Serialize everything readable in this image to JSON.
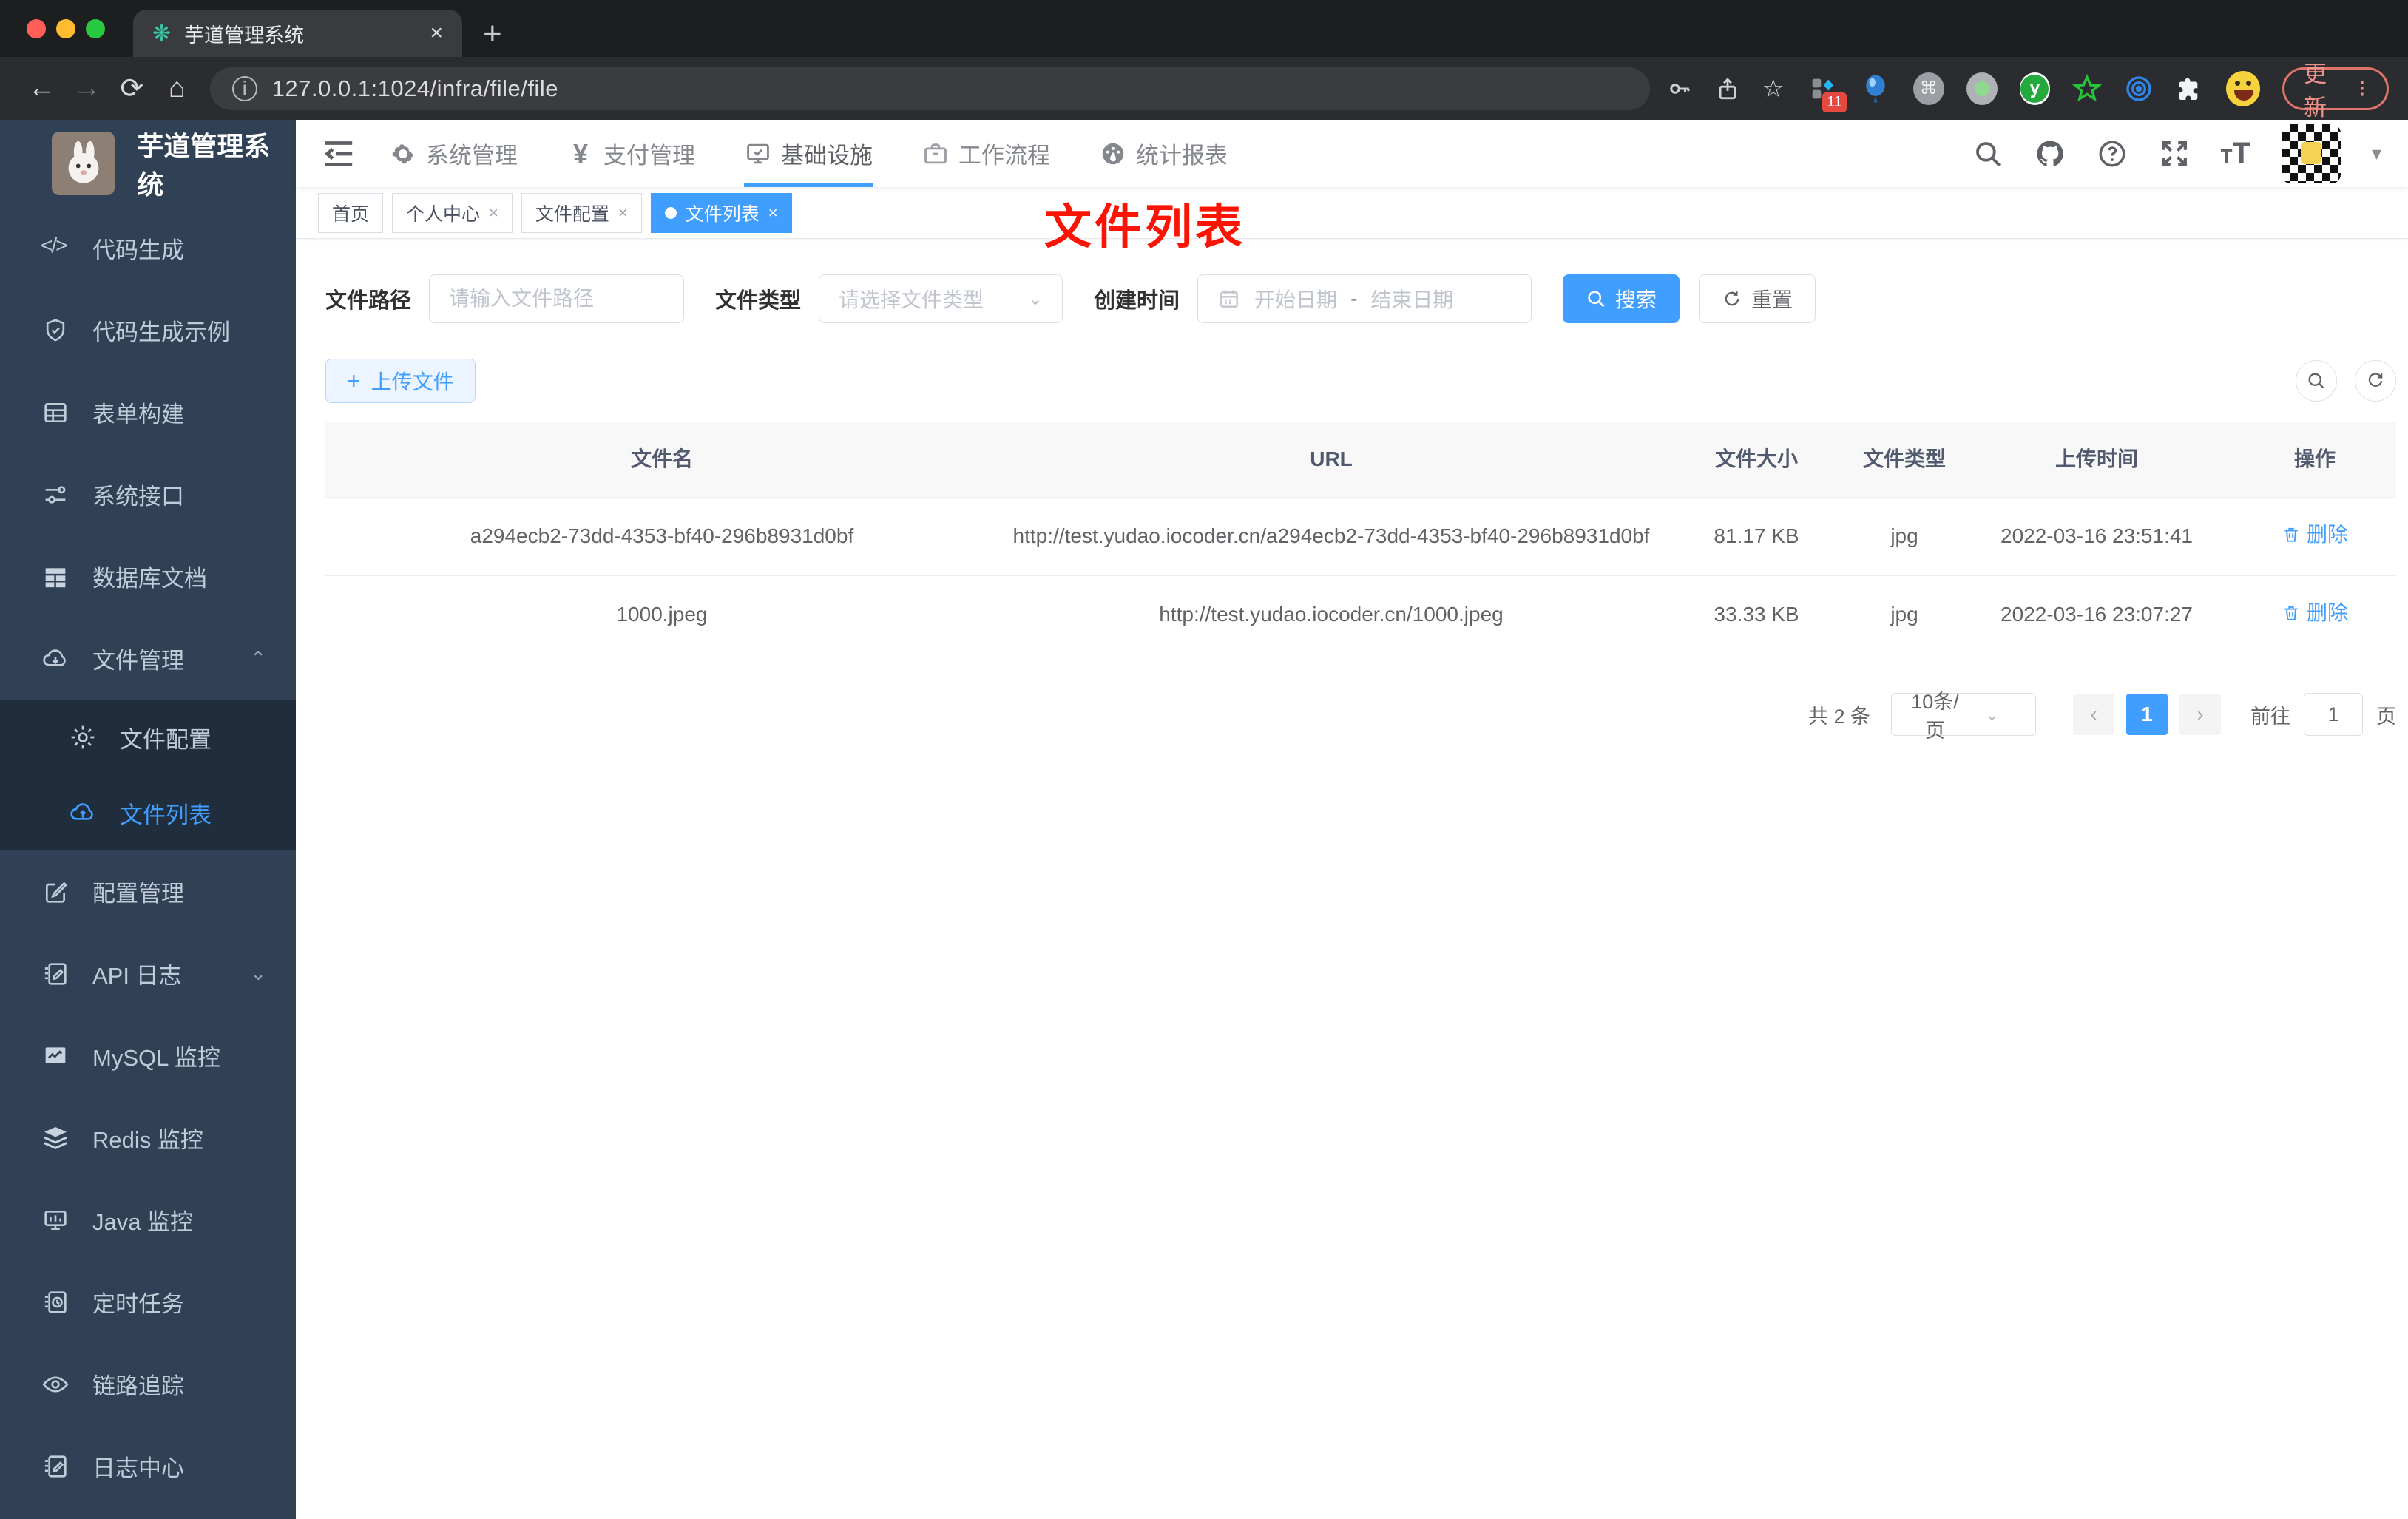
{
  "browser": {
    "tab_title": "芋道管理系统",
    "tab_close": "×",
    "new_tab": "+",
    "url": "127.0.0.1:1024/infra/file/file",
    "ext_badge": "11",
    "update_label": "更新",
    "menu_dots": "⁝"
  },
  "sidebar": {
    "title": "芋道管理系统",
    "menu": [
      {
        "label": "代码生成",
        "icon": "code-icon"
      },
      {
        "label": "代码生成示例",
        "icon": "shield-check-icon"
      },
      {
        "label": "表单构建",
        "icon": "table-icon"
      },
      {
        "label": "系统接口",
        "icon": "sliders-icon"
      },
      {
        "label": "数据库文档",
        "icon": "grid-icon"
      },
      {
        "label": "文件管理",
        "icon": "cloud-download-icon"
      },
      {
        "label": "文件配置",
        "icon": "gear-icon"
      },
      {
        "label": "文件列表",
        "icon": "cloud-upload-icon"
      },
      {
        "label": "配置管理",
        "icon": "edit-icon"
      },
      {
        "label": "API 日志",
        "icon": "log-icon"
      },
      {
        "label": "MySQL 监控",
        "icon": "monitor-chart-icon"
      },
      {
        "label": "Redis 监控",
        "icon": "layers-icon"
      },
      {
        "label": "Java 监控",
        "icon": "display-icon"
      },
      {
        "label": "定时任务",
        "icon": "clock-book-icon"
      },
      {
        "label": "链路追踪",
        "icon": "eye-icon"
      },
      {
        "label": "日志中心",
        "icon": "log-pencil-icon"
      }
    ]
  },
  "topnav": {
    "items": [
      {
        "label": "系统管理"
      },
      {
        "label": "支付管理"
      },
      {
        "label": "基础设施"
      },
      {
        "label": "工作流程"
      },
      {
        "label": "统计报表"
      }
    ]
  },
  "tags": {
    "items": [
      {
        "label": "首页"
      },
      {
        "label": "个人中心"
      },
      {
        "label": "文件配置"
      },
      {
        "label": "文件列表"
      }
    ],
    "close": "×"
  },
  "annotation": {
    "text": "文件列表"
  },
  "filter": {
    "path_label": "文件路径",
    "path_placeholder": "请输入文件路径",
    "type_label": "文件类型",
    "type_placeholder": "请选择文件类型",
    "date_label": "创建时间",
    "date_start": "开始日期",
    "date_sep": "-",
    "date_end": "结束日期",
    "search_label": "搜索",
    "reset_label": "重置"
  },
  "toolbar": {
    "upload_label": "上传文件"
  },
  "table": {
    "columns": [
      "文件名",
      "URL",
      "文件大小",
      "文件类型",
      "上传时间",
      "操作"
    ],
    "rows": [
      {
        "name": "a294ecb2-73dd-4353-bf40-296b8931d0bf",
        "url": "http://test.yudao.iocoder.cn/a294ecb2-73dd-4353-bf40-296b8931d0bf",
        "size": "81.17 KB",
        "type": "jpg",
        "time": "2022-03-16 23:51:41",
        "action": "删除"
      },
      {
        "name": "1000.jpeg",
        "url": "http://test.yudao.iocoder.cn/1000.jpeg",
        "size": "33.33 KB",
        "type": "jpg",
        "time": "2022-03-16 23:07:27",
        "action": "删除"
      }
    ]
  },
  "pagination": {
    "total": "共 2 条",
    "page_size": "10条/页",
    "prev": "‹",
    "page": "1",
    "next": "›",
    "goto_label": "前往",
    "goto_value": "1",
    "unit": "页"
  },
  "colors": {
    "accent": "#409eff",
    "sidebar_bg": "#304156",
    "submenu_bg": "#1f2d3d",
    "annotation_red": "#fb1303"
  }
}
